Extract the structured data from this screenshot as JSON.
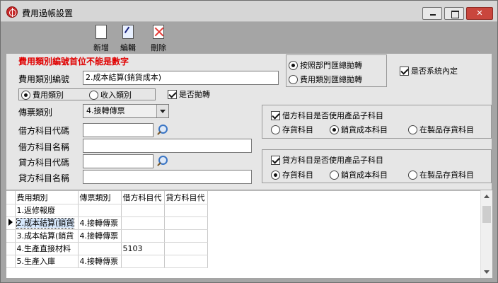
{
  "window": {
    "title": "費用過帳設置"
  },
  "toolbar": {
    "new_label": "新增",
    "edit_label": "編輯",
    "delete_label": "刪除"
  },
  "form": {
    "warning": "費用類別編號首位不能是數字",
    "category_label": "費用類別編號",
    "category_value": "2.成本結算(銷貨成本)",
    "type_expense": "費用類別",
    "type_income": "收入類別",
    "auto_transfer_label": "是否拋轉",
    "voucher_label": "傳票類別",
    "voucher_value": "4.接轉傳票",
    "debit_code_label": "借方科目代碼",
    "debit_name_label": "借方科目名稱",
    "credit_code_label": "貸方科目代碼",
    "credit_name_label": "貸方科目名稱",
    "summary_by_dept": "按照部門匯總拋轉",
    "summary_by_category": "費用類別匯總拋轉",
    "system_builtin": "是否系統內定"
  },
  "debit_group": {
    "title": "借方科目是否使用產品子科目",
    "opt_inventory": "存貨科目",
    "opt_cost": "銷貨成本科目",
    "opt_wip": "在製品存貨科目"
  },
  "credit_group": {
    "title": "貸方科目是否使用產品子科目",
    "opt_inventory": "存貨科目",
    "opt_cost": "銷貨成本科目",
    "opt_wip": "在製品存貨科目"
  },
  "grid": {
    "headers": [
      "費用類別",
      "傳票類別",
      "借方科目代",
      "貸方科目代"
    ],
    "rows": [
      [
        "1.返修報廢",
        "",
        "",
        ""
      ],
      [
        "2.成本結算(銷貨",
        "4.接轉傳票",
        "",
        ""
      ],
      [
        "3.成本結算(銷貨",
        "4.接轉傳票",
        "",
        ""
      ],
      [
        "4.生產直接材料",
        "",
        "5103",
        ""
      ],
      [
        "5.生產入庫",
        "4.接轉傳票",
        "",
        ""
      ]
    ]
  }
}
